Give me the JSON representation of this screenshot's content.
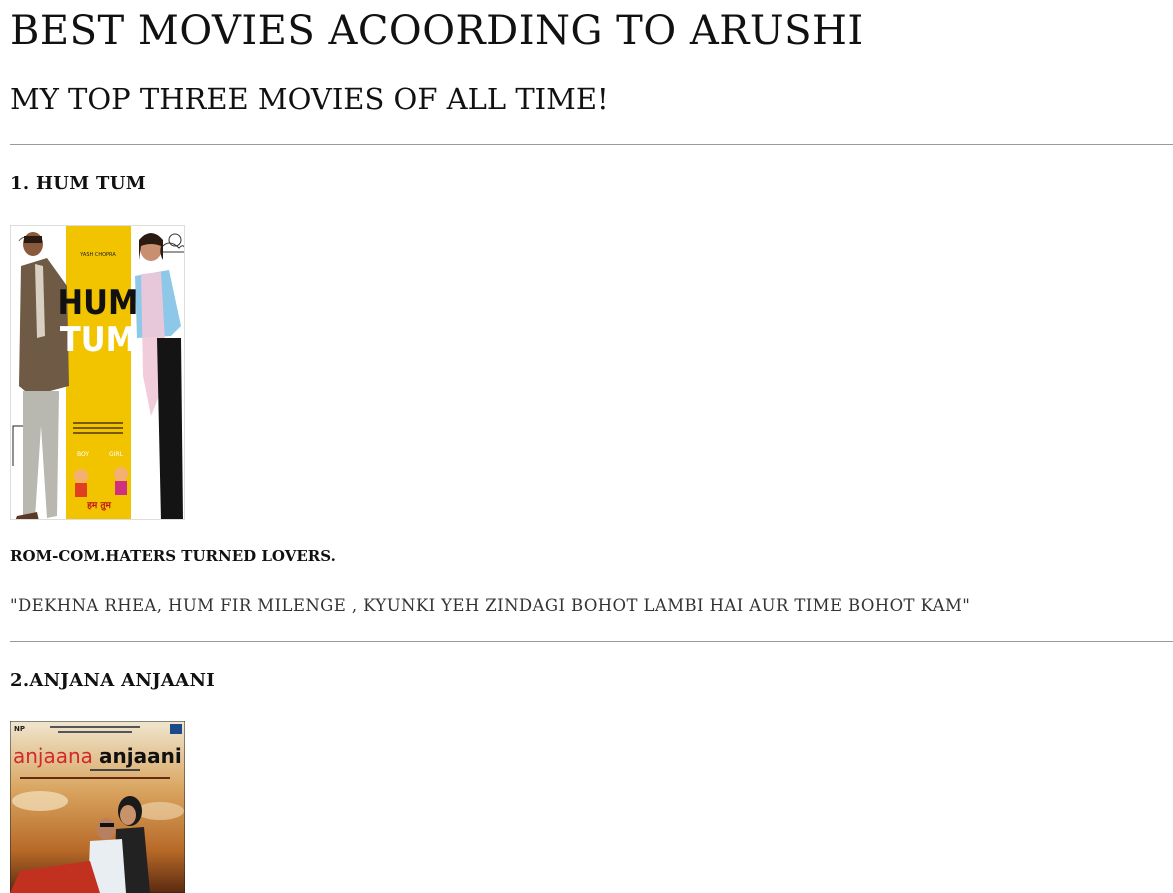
{
  "header": {
    "title": "BEST MOVIES ACOORDING TO ARUSHI",
    "subtitle": "MY TOP THREE MOVIES OF ALL TIME!"
  },
  "movies": [
    {
      "title": "1. HUM TUM",
      "poster": {
        "icon": "hum-tum-poster-image",
        "studio": "YASH CHOPRA",
        "text_line1": "HUM",
        "text_line2": "TUM",
        "bottom_left": "BOY",
        "bottom_right": "GIRL",
        "hindi": "हम तुम"
      },
      "genre": "ROM-COM.HATERS TURNED LOVERS.",
      "quote": "\"DEKHNA RHEA, HUM FIR MILENGE , KYUNKI YEH ZINDAGI BOHOT LAMBI HAI AUR TIME BOHOT KAM\""
    },
    {
      "title": "2.ANJANA ANJAANI",
      "poster": {
        "icon": "anjaana-anjaani-poster-image",
        "title_part1": "anjaana",
        "title_part2": "anjaani",
        "corner": "NP"
      }
    }
  ],
  "colors": {
    "text": "#111111",
    "divider": "#9a9a9a",
    "hum_tum_yellow": "#f2c400",
    "anjaana_red": "#d3282a"
  }
}
